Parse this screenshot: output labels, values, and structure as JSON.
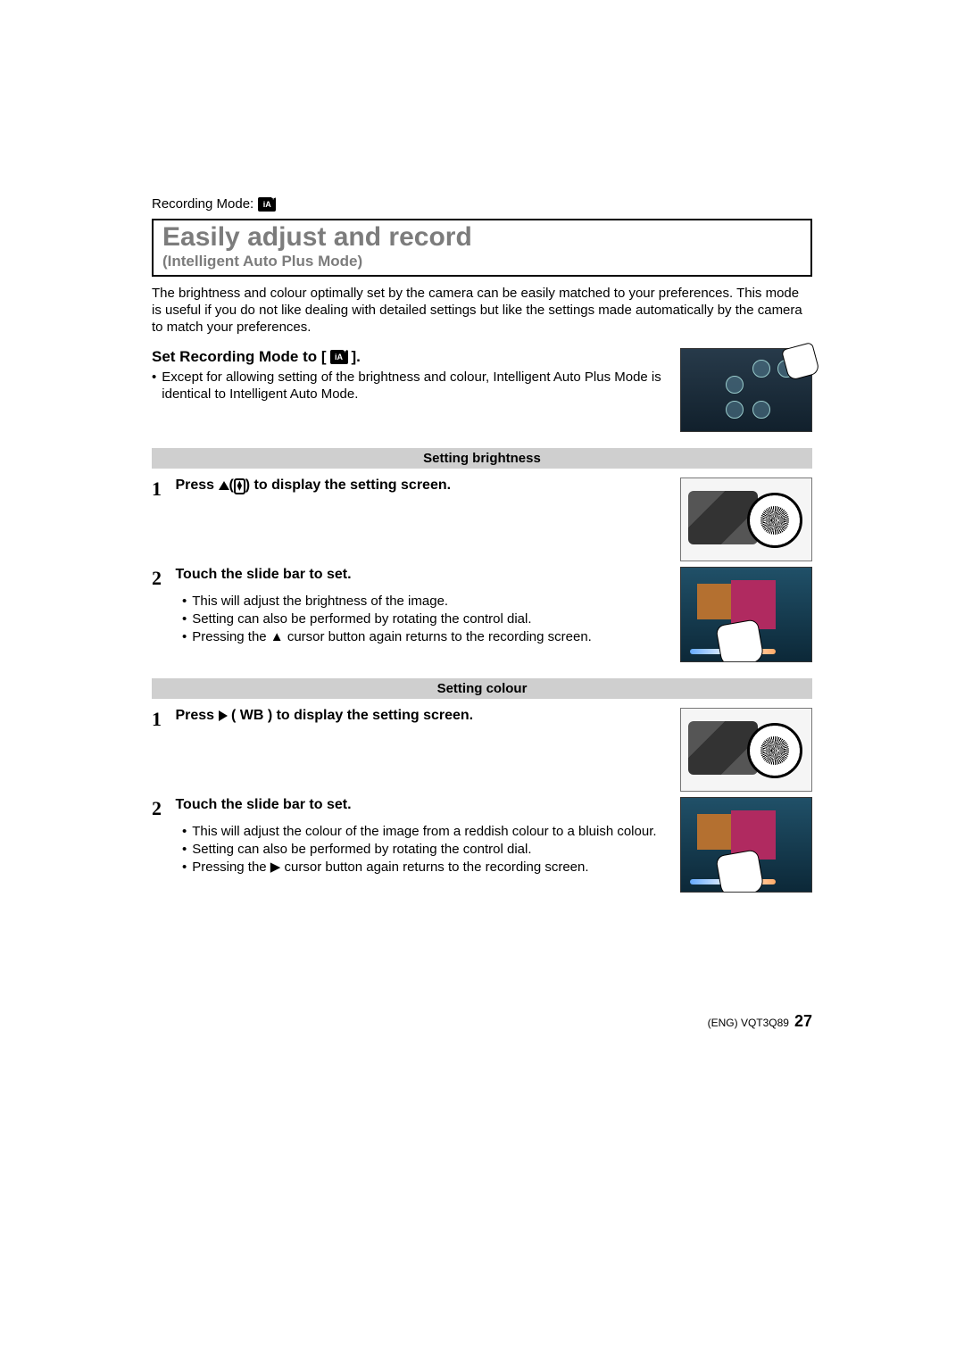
{
  "header": {
    "recording_mode_label": "Recording Mode:",
    "mode_icon_text": "iA"
  },
  "title_box": {
    "title": "Easily adjust and record",
    "subtitle": "(Intelligent Auto Plus Mode)"
  },
  "intro": "The brightness and colour optimally set by the camera can be easily matched to your preferences. This mode is useful if you do not like dealing with detailed settings but like the settings made automatically by the camera to match your preferences.",
  "set_heading": {
    "prefix": "Set Recording Mode to [",
    "icon_text": "iA",
    "suffix": "]."
  },
  "set_note": "Except for allowing setting of the brightness and colour, Intelligent Auto Plus Mode is identical to Intelligent Auto Mode.",
  "brightness": {
    "bar": "Setting brightness",
    "step1_num": "1",
    "step1_pre": "Press ",
    "step1_mid_open": "(",
    "step1_mid_close": ")",
    "step1_post": " to display the setting screen.",
    "step2_num": "2",
    "step2_title": "Touch the slide bar to set.",
    "step2_bullets": [
      "This will adjust the brightness of the image.",
      "Setting can also be performed by rotating the control dial.",
      "Pressing the ▲ cursor button again returns to the recording screen."
    ]
  },
  "colour": {
    "bar": "Setting colour",
    "step1_num": "1",
    "step1_pre": "Press ",
    "step1_wb_open": " ( ",
    "step1_wb_label": "WB",
    "step1_wb_close": " )",
    "step1_post": " to display the setting screen.",
    "step2_num": "2",
    "step2_title": "Touch the slide bar to set.",
    "step2_bullets": [
      "This will adjust the colour of the image from a reddish colour to a bluish colour.",
      "Setting can also be performed by rotating the control dial.",
      "Pressing the ▶ cursor button again returns to the recording screen."
    ]
  },
  "footer": {
    "code": "(ENG) VQT3Q89",
    "page": "27"
  }
}
